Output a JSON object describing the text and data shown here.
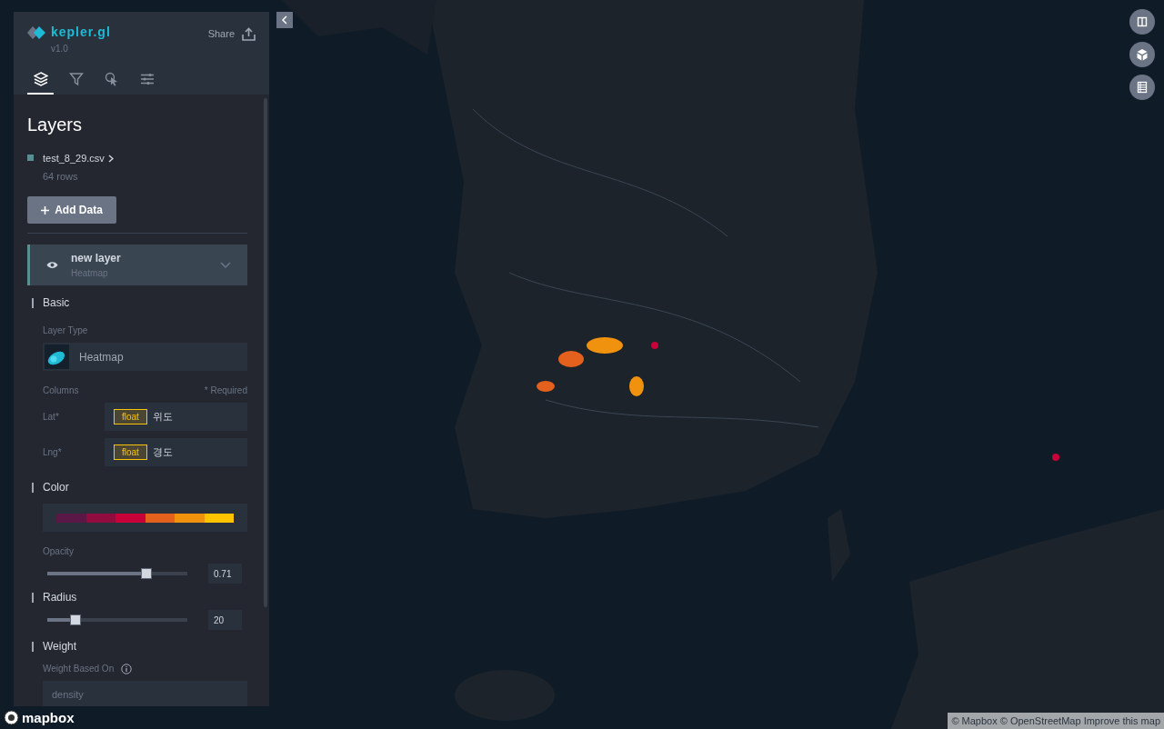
{
  "app": {
    "name": "kepler.gl",
    "version": "v1.0",
    "share": "Share"
  },
  "tabs": [
    {
      "kind": "layers",
      "selected": true
    },
    {
      "kind": "filters",
      "selected": false
    },
    {
      "kind": "interactions",
      "selected": false
    },
    {
      "kind": "map-style",
      "selected": false
    }
  ],
  "panel": {
    "title": "Layers",
    "dataset": {
      "name": "test_8_29.csv",
      "rows": "64 rows",
      "color": "#5b8d93"
    },
    "add_button": "Add Data",
    "layer": {
      "name": "new layer",
      "type": "Heatmap",
      "visible": true,
      "section_titles": [
        "Basic",
        "Color",
        "Radius",
        "Weight"
      ],
      "layer_type_label": "Layer Type",
      "layer_type": "Heatmap",
      "columns_label": "Columns",
      "required": "* Required",
      "columns": [
        {
          "label": "Lat*",
          "type": "float",
          "field": "위도"
        },
        {
          "label": "Lng*",
          "type": "float",
          "field": "경도"
        }
      ],
      "palette": [
        {
          "color": "#5a1846"
        },
        {
          "color": "#900c3f"
        },
        {
          "color": "#c70039"
        },
        {
          "color": "#e3611c"
        },
        {
          "color": "#f1920e"
        },
        {
          "color": "#ffc300"
        }
      ],
      "opacity": {
        "label": "Opacity",
        "level": 0.71,
        "value": "0.71"
      },
      "radius": {
        "level": 0.2,
        "value": "20"
      },
      "weight_label": "Weight Based On",
      "weight_value": "density"
    }
  },
  "map_controls": [
    {
      "kind": "split"
    },
    {
      "kind": "cube"
    },
    {
      "kind": "legend"
    }
  ],
  "attribution": {
    "logo": "mapbox",
    "text": "© Mapbox © OpenStreetMap Improve this map"
  }
}
